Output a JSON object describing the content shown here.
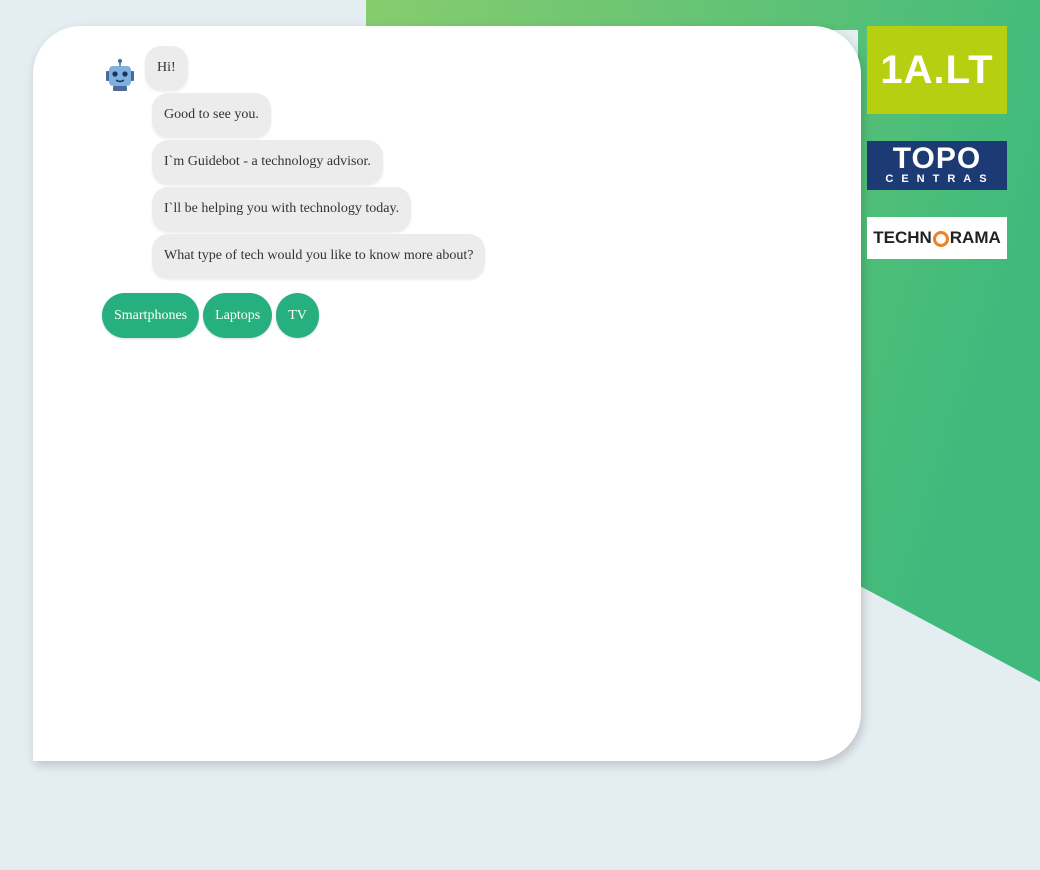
{
  "chat": {
    "messages": [
      "Hi!",
      "Good to see you.",
      "I`m Guidebot - a technology advisor.",
      "I`ll be helping you with technology today.",
      "What type of tech would you like to know more about?"
    ],
    "choices": [
      "Smartphones",
      "Laptops",
      "TV"
    ]
  },
  "partners": [
    {
      "name": "1A.LT",
      "color": "#b7cf11"
    },
    {
      "name": "TOPO",
      "subtitle": "CENTRAS",
      "color": "#1c3a73"
    },
    {
      "name_parts": [
        "TECHN",
        "RAMA"
      ],
      "accent": "#f08020"
    }
  ],
  "colors": {
    "background": "#e4edf1",
    "gradient_start": "#87cc6e",
    "gradient_end": "#3fba7c",
    "button": "#27b07f",
    "bubble": "#ececec"
  },
  "icons": [
    "robot-icon",
    "power-icon"
  ]
}
